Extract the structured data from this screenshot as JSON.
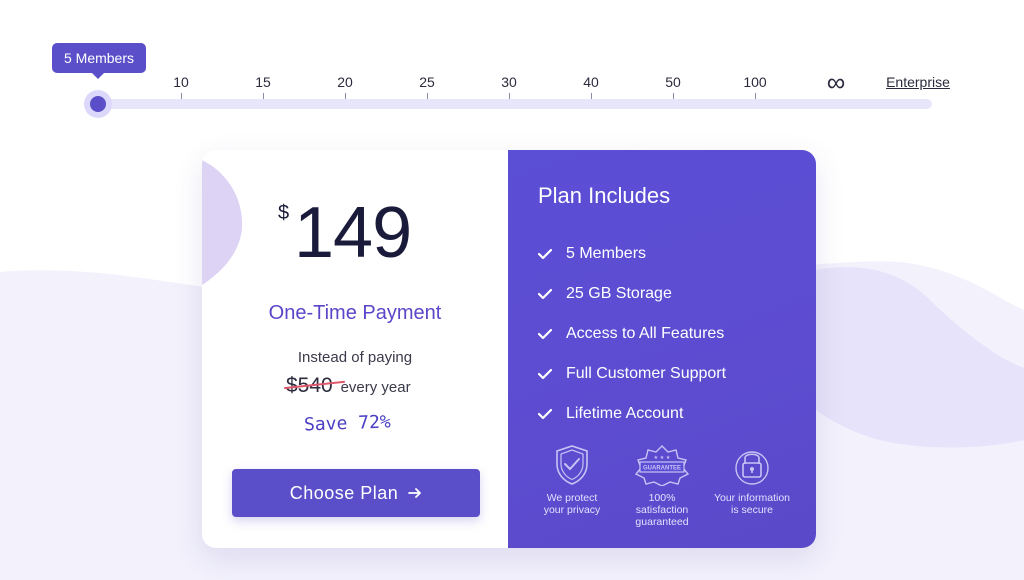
{
  "slider": {
    "tooltip": "5 Members",
    "value": 5,
    "ticks": [
      "10",
      "15",
      "20",
      "25",
      "30",
      "40",
      "50",
      "100"
    ],
    "infinity": "∞",
    "enterprise": "Enterprise"
  },
  "pricing": {
    "currency": "$",
    "amount": "149",
    "payment_type": "One-Time Payment",
    "instead_label": "Instead of paying",
    "old_price": "$540",
    "old_price_suffix": "every year",
    "save_text": "Save 72%",
    "cta_label": "Choose Plan"
  },
  "plan": {
    "title": "Plan Includes",
    "features": [
      "5 Members",
      "25 GB Storage",
      "Access to All Features",
      "Full Customer Support",
      "Lifetime Account"
    ]
  },
  "badges": [
    {
      "icon": "shield-check-icon",
      "line1": "We protect",
      "line2": "your privacy"
    },
    {
      "icon": "guarantee-seal-icon",
      "seal_text": "GUARANTEE",
      "line1": "100% satisfaction",
      "line2": "guaranteed"
    },
    {
      "icon": "padlock-icon",
      "line1": "Your information",
      "line2": "is secure"
    }
  ],
  "colors": {
    "accent": "#5b4fc9",
    "panel": "#5b4fd6",
    "strike": "#e0566a",
    "peach": "#f0a89d"
  }
}
